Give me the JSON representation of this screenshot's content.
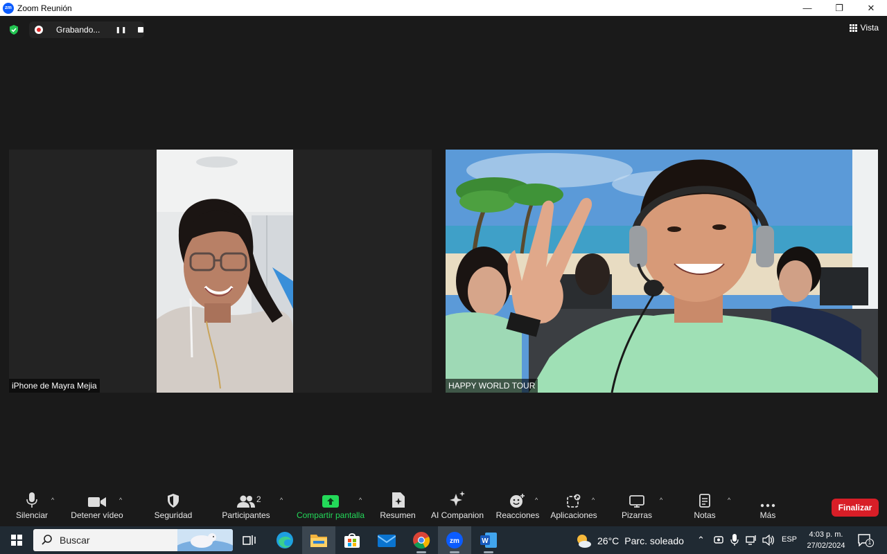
{
  "window": {
    "app_icon_text": "zm",
    "title": "Zoom Reunión",
    "minimize": "—",
    "restore": "❐",
    "close": "✕"
  },
  "topbar": {
    "recording_label": "Grabando...",
    "view_label": "Vista"
  },
  "participants": [
    {
      "name": "iPhone de Mayra Mejia"
    },
    {
      "name": "HAPPY WORLD TOUR"
    }
  ],
  "toolbar": {
    "mute": "Silenciar",
    "video": "Detener vídeo",
    "security": "Seguridad",
    "participants": "Participantes",
    "participants_count": "2",
    "share": "Compartir pantalla",
    "summary": "Resumen",
    "ai": "AI Companion",
    "reactions": "Reacciones",
    "apps": "Aplicaciones",
    "whiteboards": "Pizarras",
    "notes": "Notas",
    "more": "Más",
    "end": "Finalizar"
  },
  "taskbar": {
    "search_label": "Buscar",
    "weather_temp": "26°C",
    "weather_desc": "Parc. soleado",
    "language": "ESP",
    "time": "4:03 p. m.",
    "date": "27/02/2024",
    "notification_count": "1"
  },
  "colors": {
    "accent_green": "#23d959",
    "end_red": "#d81e27",
    "zoom_blue": "#0b5cff"
  }
}
